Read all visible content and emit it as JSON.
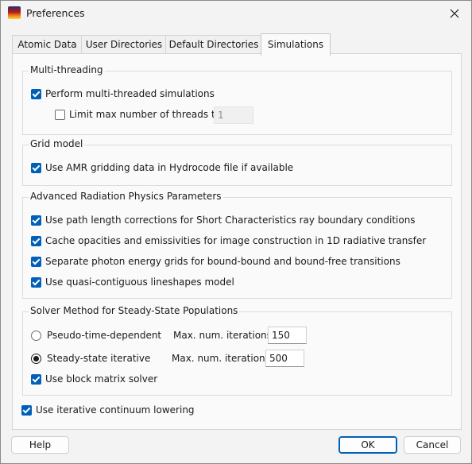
{
  "window": {
    "title": "Preferences",
    "app_icon": "app-logo-icon",
    "close_icon": "close-icon"
  },
  "tabs": [
    {
      "label": "Atomic Data"
    },
    {
      "label": "User Directories"
    },
    {
      "label": "Default Directories"
    },
    {
      "label": "Simulations",
      "active": true
    }
  ],
  "multithreading": {
    "title": "Multi-threading",
    "perform_label": "Perform multi-threaded simulations",
    "perform_checked": true,
    "limit_label": "Limit max number of threads to:",
    "limit_checked": false,
    "limit_value": "1"
  },
  "grid_model": {
    "title": "Grid model",
    "amr_label": "Use AMR gridding data in Hydrocode file if available",
    "amr_checked": true
  },
  "radiation": {
    "title": "Advanced Radiation Physics Parameters",
    "options": [
      {
        "label": "Use path length corrections for Short Characteristics ray boundary conditions",
        "checked": true
      },
      {
        "label": "Cache opacities and emissivities for image construction in 1D radiative transfer",
        "checked": true
      },
      {
        "label": "Separate photon energy grids for bound-bound and bound-free transitions",
        "checked": true
      },
      {
        "label": "Use quasi-contiguous lineshapes model",
        "checked": true
      }
    ]
  },
  "solver": {
    "title": "Solver Method for Steady-State Populations",
    "pseudo_label": "Pseudo-time-dependent",
    "pseudo_selected": false,
    "pseudo_iter_label": "Max. num. iterations:",
    "pseudo_iter_value": "150",
    "steady_label": "Steady-state iterative",
    "steady_selected": true,
    "steady_iter_label": "Max. num. iterations:",
    "steady_iter_value": "500",
    "block_label": "Use block matrix solver",
    "block_checked": true
  },
  "continuum": {
    "label": "Use iterative continuum lowering",
    "checked": true
  },
  "buttons": {
    "help": "Help",
    "ok": "OK",
    "cancel": "Cancel"
  },
  "colors": {
    "accent": "#005fb8",
    "background": "#f3f3f3",
    "panel": "#fafafa"
  }
}
